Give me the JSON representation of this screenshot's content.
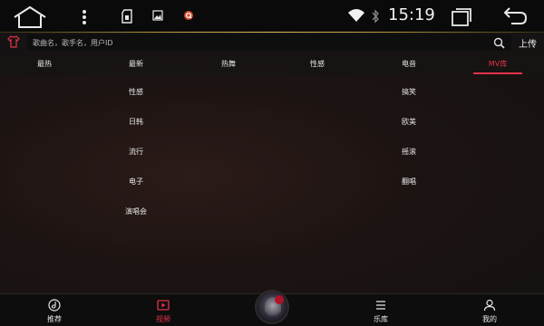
{
  "system_bar": {
    "time": "15:19",
    "icons": [
      "home-icon",
      "menu-dots-icon",
      "sd-card-icon",
      "image-icon",
      "q-app-icon",
      "wifi-icon",
      "bluetooth-icon",
      "recent-apps-icon",
      "back-icon"
    ]
  },
  "colors": {
    "accent": "#e3324a",
    "gold_line": "#d7bd55",
    "background": "#141110"
  },
  "search": {
    "placeholder": "歌曲名，歌手名，用户ID",
    "upload_label": "上传"
  },
  "tabs": [
    {
      "label": "最热",
      "active": false
    },
    {
      "label": "最新",
      "active": false
    },
    {
      "label": "热舞",
      "active": false
    },
    {
      "label": "性感",
      "active": false
    },
    {
      "label": "电音",
      "active": false
    },
    {
      "label": "MV库",
      "active": true
    }
  ],
  "categories": {
    "left": [
      "性感",
      "日韩",
      "流行",
      "电子",
      "演唱会"
    ],
    "right": [
      "搞笑",
      "欧美",
      "摇滚",
      "翻唱"
    ]
  },
  "bottom_nav": [
    {
      "label": "推荐",
      "icon": "recommend-icon",
      "active": false
    },
    {
      "label": "视频",
      "icon": "video-icon",
      "active": true
    },
    {
      "label": "乐库",
      "icon": "library-icon",
      "active": false
    },
    {
      "label": "我的",
      "icon": "profile-icon",
      "active": false
    }
  ]
}
